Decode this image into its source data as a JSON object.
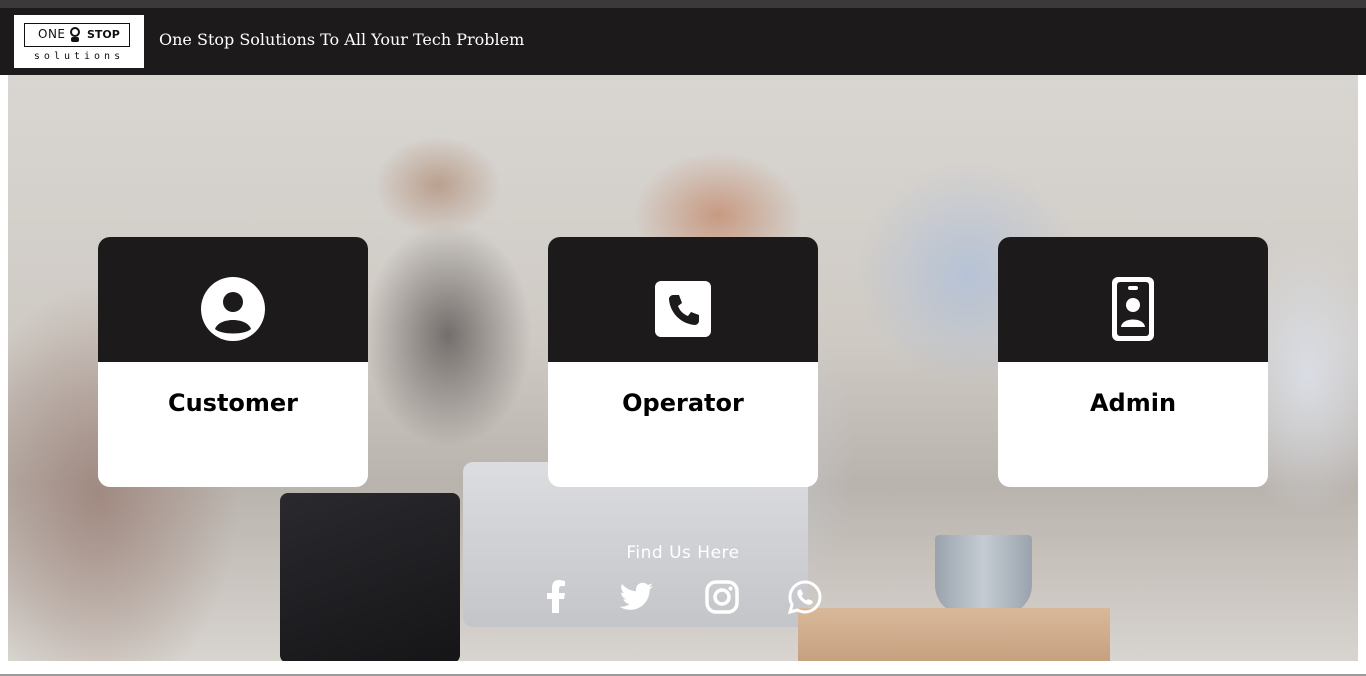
{
  "brand": {
    "logo_one": "ONE",
    "logo_stop": "STOP",
    "logo_sub": "solutions",
    "tagline": "One Stop Solutions To All Your Tech Problem"
  },
  "roles": [
    {
      "label": "Customer",
      "icon": "user-circle-icon"
    },
    {
      "label": "Operator",
      "icon": "phone-icon"
    },
    {
      "label": "Admin",
      "icon": "id-badge-icon"
    }
  ],
  "footer": {
    "find_us": "Find Us Here",
    "social": [
      "facebook-icon",
      "twitter-icon",
      "instagram-icon",
      "whatsapp-icon"
    ]
  },
  "colors": {
    "nav_bg": "#1c1a1b",
    "card_header_bg": "#1c1a1b",
    "card_body_bg": "#ffffff",
    "text_light": "#ffffff"
  }
}
